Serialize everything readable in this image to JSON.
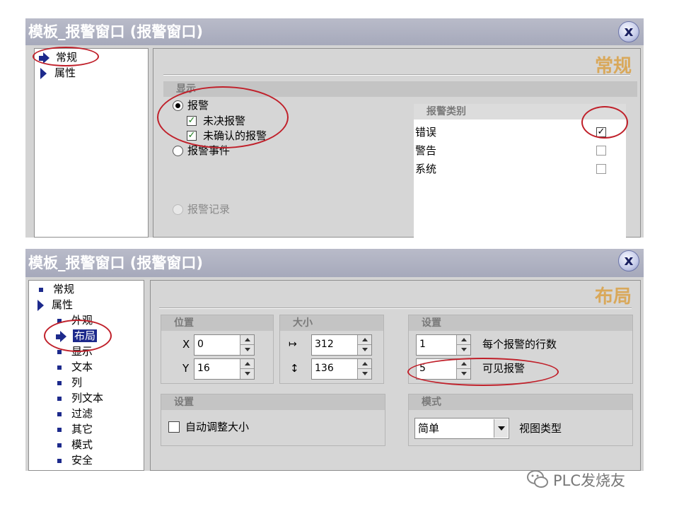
{
  "dialog1": {
    "title": "模板_报警窗口 (报警窗口)",
    "close_label": "x",
    "tree": [
      {
        "label": "常规"
      },
      {
        "label": "属性"
      }
    ],
    "heading": "常规",
    "display_group": "显示",
    "options": {
      "alarm": "报警",
      "pending": "未决报警",
      "unack": "未确认的报警",
      "alarm_event": "报警事件",
      "alarm_log": "报警记录"
    },
    "category_header": "报警类别",
    "categories": [
      {
        "label": "错误",
        "checked": true
      },
      {
        "label": "警告",
        "checked": false
      },
      {
        "label": "系统",
        "checked": false
      }
    ]
  },
  "dialog2": {
    "title": "模板_报警窗口 (报警窗口)",
    "close_label": "x",
    "heading": "布局",
    "tree": [
      "常规",
      "属性",
      "外观",
      "布局",
      "显示",
      "文本",
      "列",
      "列文本",
      "过滤",
      "其它",
      "模式",
      "安全"
    ],
    "position": {
      "title": "位置",
      "x_label": "X",
      "x": "0",
      "y_label": "Y",
      "y": "16"
    },
    "size": {
      "title": "大小",
      "width": "312",
      "height": "136"
    },
    "settings": {
      "title": "设置",
      "rows": "1",
      "rows_label": "每个报警的行数",
      "visible": "5",
      "visible_label": "可见报警"
    },
    "settings2": {
      "title": "设置",
      "autosize": "自动调整大小"
    },
    "mode": {
      "title": "模式",
      "value": "简单",
      "label": "视图类型"
    }
  },
  "watermark": "PLC发烧友"
}
